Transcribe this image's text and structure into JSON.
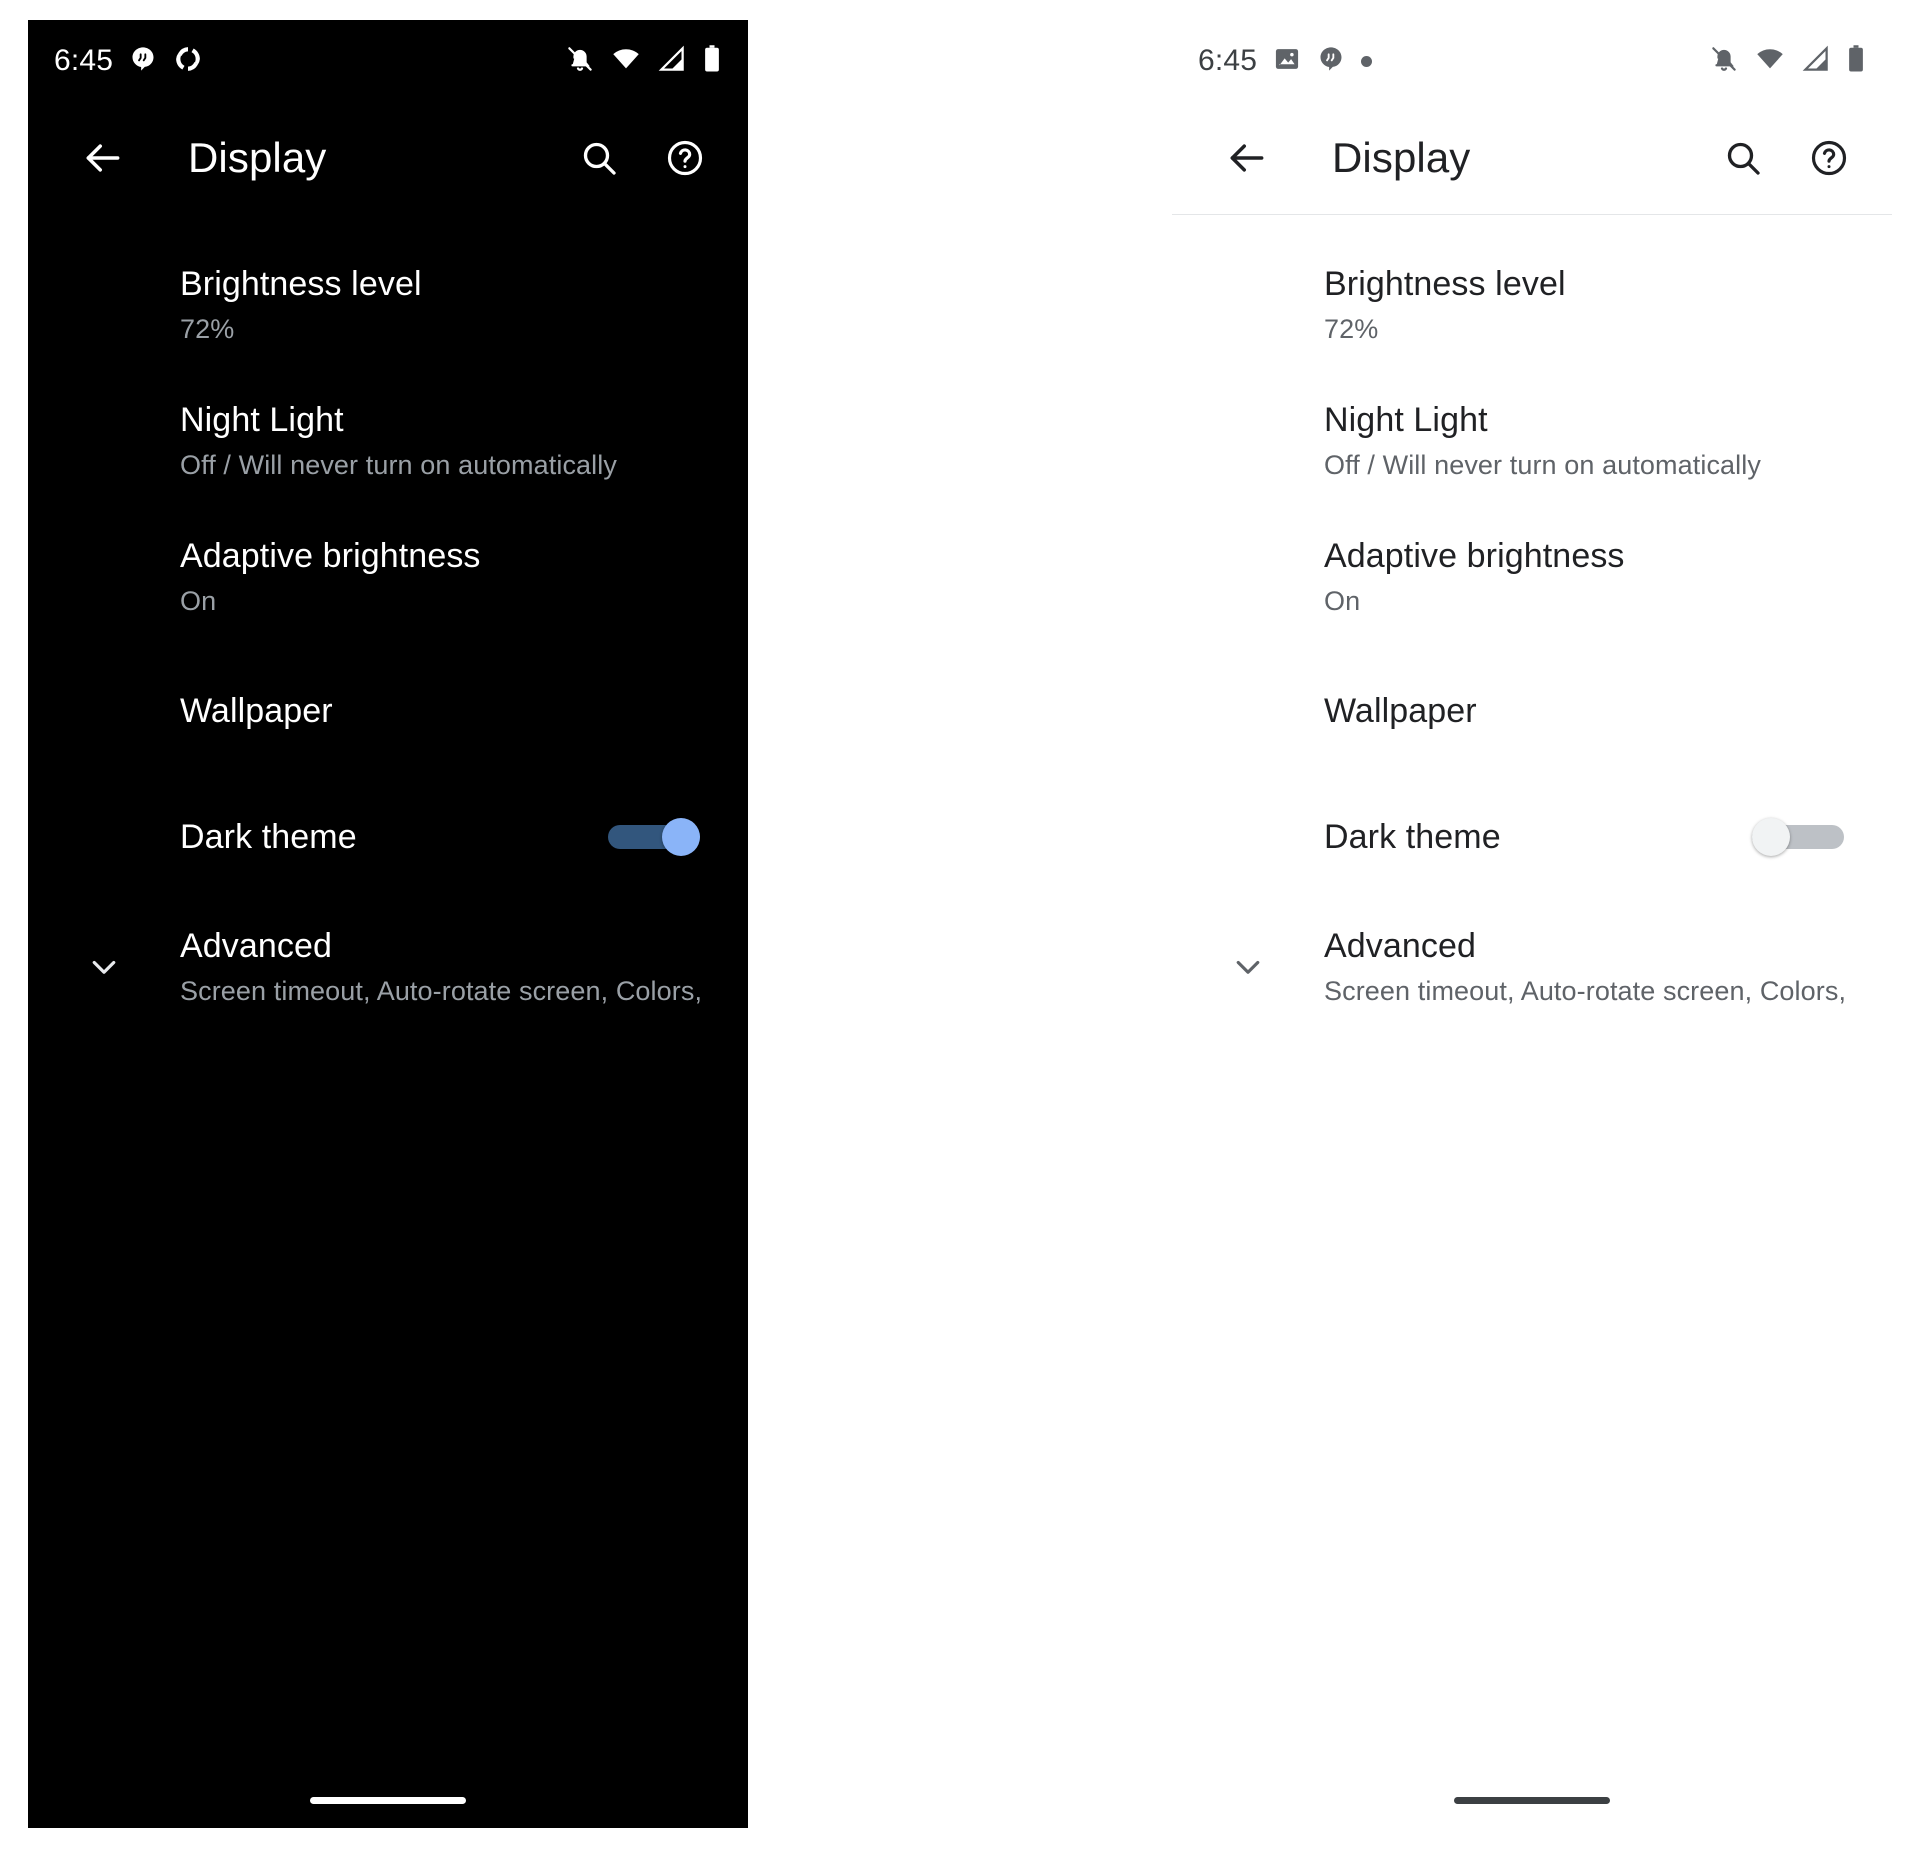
{
  "screens": [
    {
      "theme": "dark",
      "status_bar": {
        "time": "6:45",
        "left_icons": [
          "hangouts-icon",
          "sync-icon"
        ],
        "right_icons": [
          "notifications-off-icon",
          "wifi-icon",
          "cellular-signal-icon",
          "battery-icon"
        ]
      },
      "app_bar": {
        "back_label": "back-arrow",
        "title": "Display",
        "search_label": "search-icon",
        "help_label": "help-icon"
      },
      "items": [
        {
          "title": "Brightness level",
          "subtitle": "72%"
        },
        {
          "title": "Night Light",
          "subtitle": "Off / Will never turn on automatically"
        },
        {
          "title": "Adaptive brightness",
          "subtitle": "On"
        },
        {
          "title": "Wallpaper",
          "subtitle": ""
        },
        {
          "title": "Dark theme",
          "subtitle": "",
          "switch": "on"
        },
        {
          "title": "Advanced",
          "subtitle": "Screen timeout, Auto-rotate screen, Colors, Font si.."
        }
      ],
      "colors": {
        "background": "#000000",
        "primary_text": "#ffffff",
        "secondary_text": "#9aa0a6",
        "switch_thumb": "#8ab4f8",
        "switch_track": "#32567d"
      }
    },
    {
      "theme": "light",
      "status_bar": {
        "time": "6:45",
        "left_icons": [
          "image-icon",
          "hangouts-icon",
          "dot-icon"
        ],
        "right_icons": [
          "notifications-off-icon",
          "wifi-icon",
          "cellular-signal-icon",
          "battery-icon"
        ]
      },
      "app_bar": {
        "back_label": "back-arrow",
        "title": "Display",
        "search_label": "search-icon",
        "help_label": "help-icon"
      },
      "items": [
        {
          "title": "Brightness level",
          "subtitle": "72%"
        },
        {
          "title": "Night Light",
          "subtitle": "Off / Will never turn on automatically"
        },
        {
          "title": "Adaptive brightness",
          "subtitle": "On"
        },
        {
          "title": "Wallpaper",
          "subtitle": ""
        },
        {
          "title": "Dark theme",
          "subtitle": "",
          "switch": "off"
        },
        {
          "title": "Advanced",
          "subtitle": "Screen timeout, Auto-rotate screen, Colors, Font si.."
        }
      ],
      "colors": {
        "background": "#ffffff",
        "primary_text": "#202124",
        "secondary_text": "#5f6368",
        "switch_thumb": "#f1f3f4",
        "switch_track": "#bdc1c6"
      }
    }
  ]
}
